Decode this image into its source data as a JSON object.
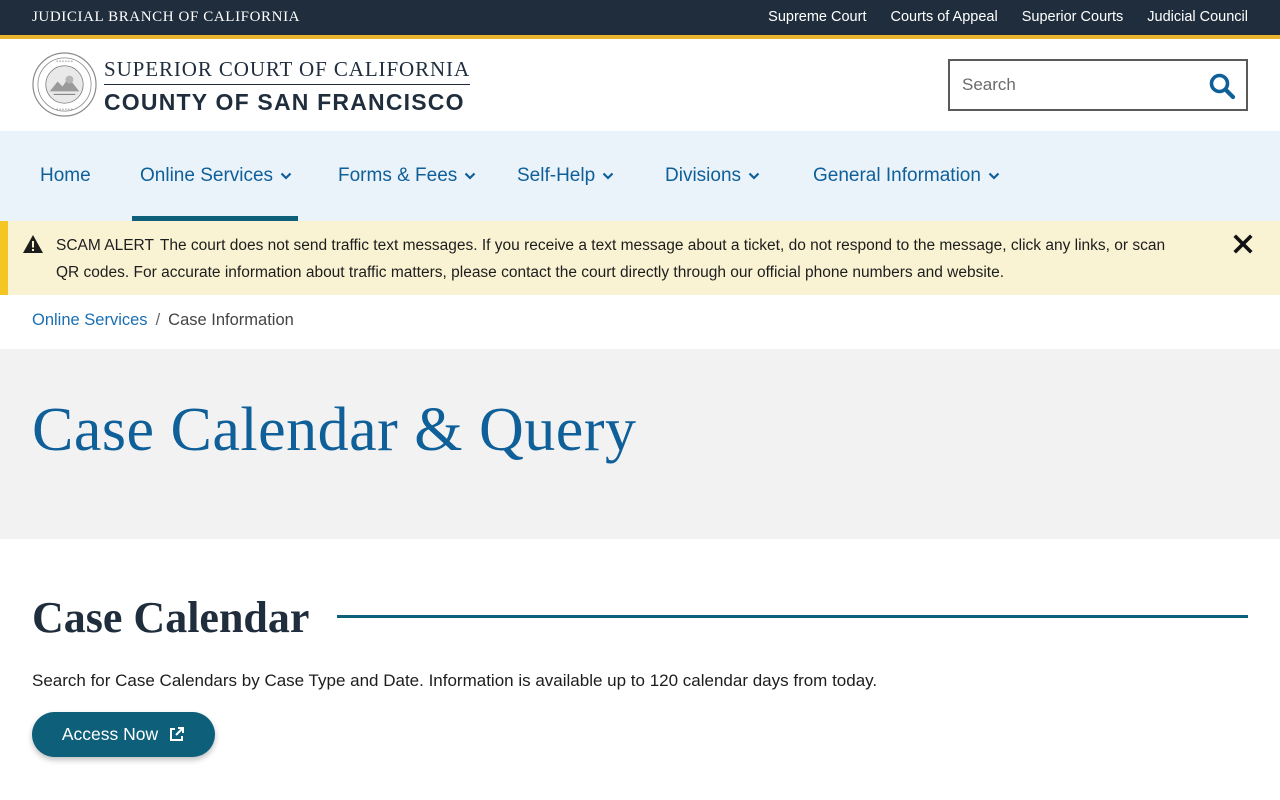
{
  "topbar": {
    "branch": "JUDICIAL BRANCH OF CALIFORNIA",
    "links": [
      "Supreme Court",
      "Courts of Appeal",
      "Superior Courts",
      "Judicial Council"
    ],
    "bg_color": "#1f2d3d",
    "stripe_color": "#e8b32f"
  },
  "header": {
    "seal_icon": "court-seal-icon",
    "court_line1": "SUPERIOR COURT OF CALIFORNIA",
    "court_line2": "COUNTY OF SAN FRANCISCO",
    "search": {
      "placeholder": "Search",
      "icon": "search-icon"
    }
  },
  "nav": {
    "items": [
      {
        "label": "Home"
      },
      {
        "label": "Online Services"
      },
      {
        "label": "Forms & Fees"
      },
      {
        "label": "Self-Help"
      },
      {
        "label": "Divisions"
      },
      {
        "label": "General Information"
      }
    ],
    "active": "Online Services",
    "bg_color": "#eaf2fa",
    "link_color": "#0f5f99"
  },
  "alert": {
    "label": "SCAM ALERT",
    "message": "The court does not send traffic text messages.  If you receive a text message about a ticket, do not respond to the message, click any links, or scan QR codes.  For accurate information about traffic matters, please contact the court directly through our official phone numbers and website.",
    "icon": "warning-icon",
    "close_icon": "close-icon",
    "bg_color": "#f9f3d3",
    "accent_color": "#f3c623"
  },
  "breadcrumb": {
    "parent": "Online Services",
    "separator": "/",
    "current": "Case Information"
  },
  "hero": {
    "title": "Case Calendar & Query"
  },
  "section": {
    "title": "Case Calendar",
    "description": "Search for Case Calendars by Case Type and Date. Information is available up to 120 calendar days from today.",
    "button_label": "Access Now",
    "button_icon": "external-link-icon",
    "button_color": "#0e5f7a"
  }
}
